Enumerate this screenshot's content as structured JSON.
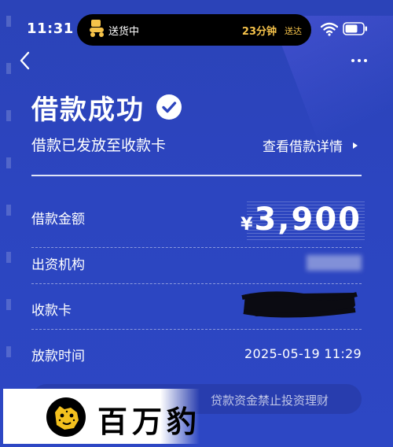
{
  "status_bar": {
    "time": "11:31",
    "delivery_label": "送货中",
    "delivery_eta": "23分钟",
    "delivery_suffix": "送达",
    "eta_color": "#f5c24a",
    "icons": [
      "delivery-scooter-icon",
      "wifi-icon",
      "battery-icon"
    ]
  },
  "nav": {
    "back_icon": "chevron-left-icon",
    "more_icon": "more-dots-icon"
  },
  "header": {
    "title": "借款成功",
    "subtitle": "借款已发放至收款卡",
    "detail_link": "查看借款详情",
    "badge_icon": "check-badge-icon"
  },
  "details": {
    "amount_label": "借款金额",
    "amount_currency": "¥",
    "amount_value": "3,900",
    "lender_label": "出资机构",
    "card_label": "收款卡",
    "time_label": "放款时间",
    "time_value": "2025-05-19 11:29"
  },
  "notice": {
    "text": "贷款资金禁止投资理财"
  },
  "brand": {
    "name": "百万豹",
    "logo_icon": "leopard-logo-icon"
  },
  "colors": {
    "background": "#2c44bd",
    "text": "#ffffff",
    "accent_eta": "#f5c24a"
  }
}
